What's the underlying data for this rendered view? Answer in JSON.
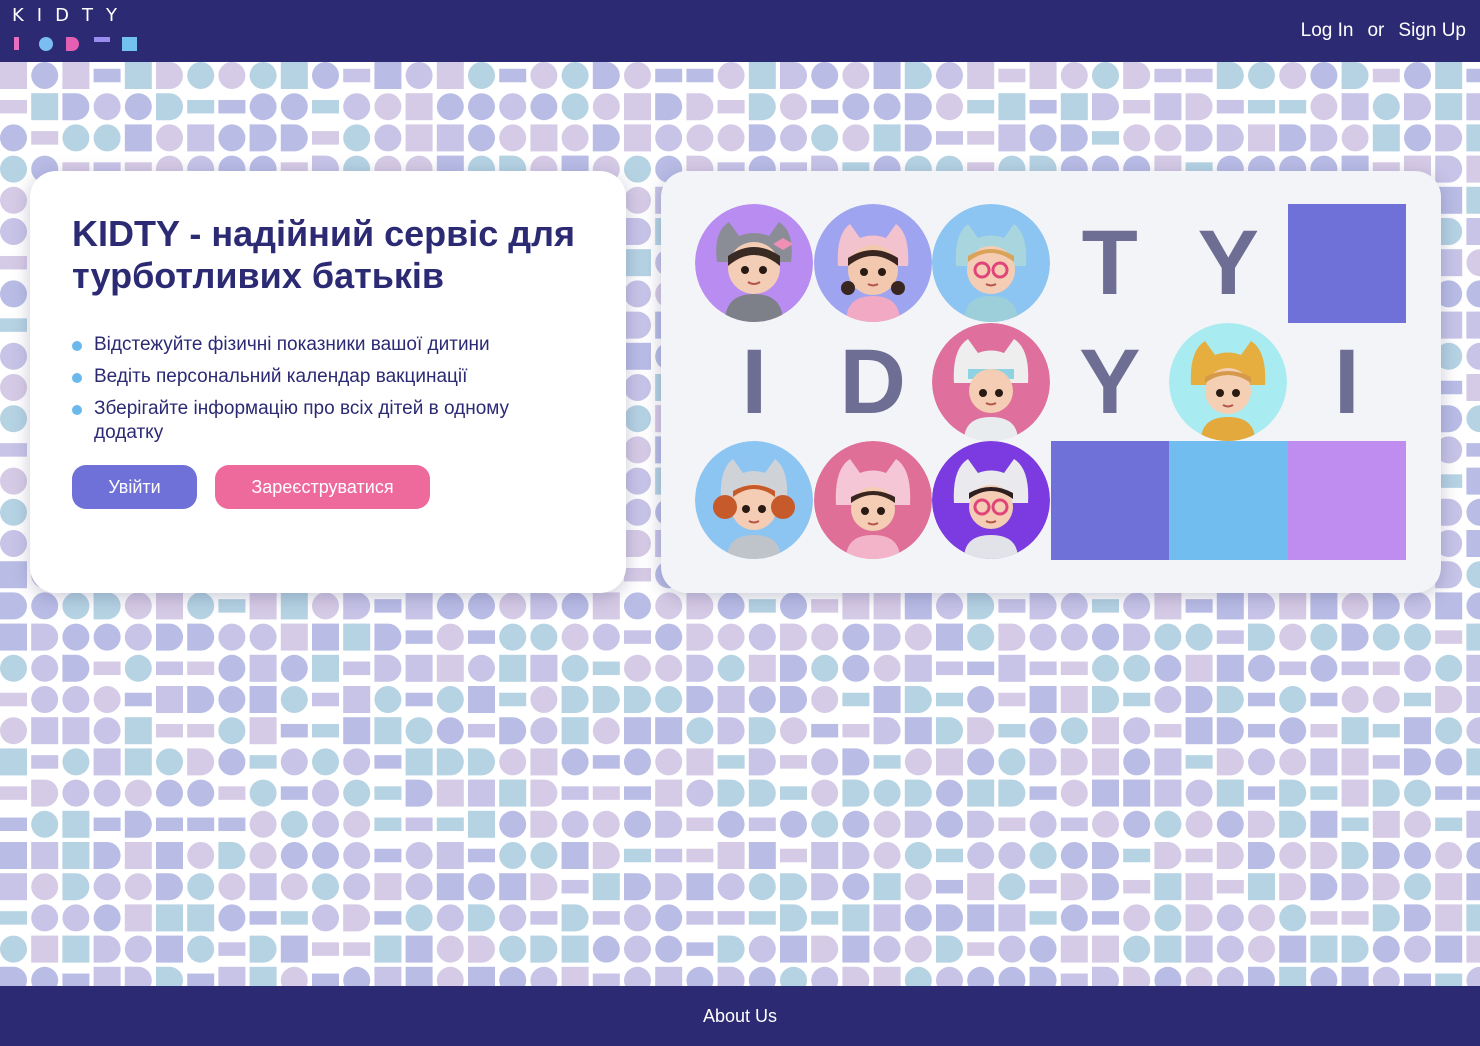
{
  "header": {
    "logo_text": "KIDTY",
    "nav": {
      "login": "Log In",
      "separator": "or",
      "signup": "Sign Up"
    }
  },
  "hero": {
    "headline": "KIDTY - надійний сервіс для турботливих батьків",
    "features": [
      "Відстежуйте фізичні показники вашої дитини",
      "Ведіть персональний календар вакцинації",
      "Зберігайте інформацію про всіх дітей в одному додатку"
    ],
    "login_button": "Увійти",
    "signup_button": "Зареєструватися"
  },
  "collage": {
    "row1": [
      "avatar",
      "avatar",
      "avatar",
      "T",
      "Y",
      "square"
    ],
    "row2": [
      "I",
      "D",
      "avatar",
      "Y",
      "avatar",
      "I"
    ],
    "row3": [
      "avatar",
      "avatar",
      "avatar",
      "square",
      "square",
      "square"
    ]
  },
  "footer": {
    "about": "About Us"
  },
  "colors": {
    "navy": "#2b2a73",
    "indigo": "#6f70d8",
    "pink": "#ee6a9d",
    "sky": "#72bdf0",
    "lilac": "#bf8cf0",
    "letter_gray": "#6e6e94"
  }
}
